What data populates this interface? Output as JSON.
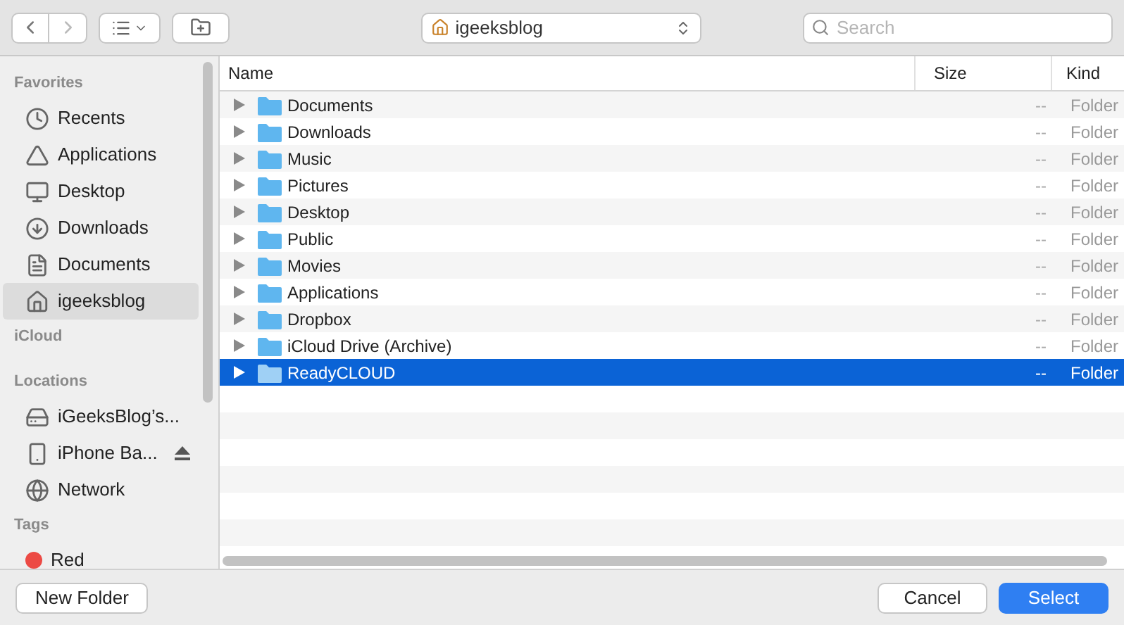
{
  "toolbar": {
    "path": "igeeksblog",
    "search": {
      "placeholder": "Search"
    }
  },
  "sidebar": {
    "sections": [
      {
        "title": "Favorites",
        "items": [
          {
            "label": "Recents",
            "kind": "recents",
            "selected": false
          },
          {
            "label": "Applications",
            "kind": "applications",
            "selected": false
          },
          {
            "label": "Desktop",
            "kind": "desktop",
            "selected": false
          },
          {
            "label": "Downloads",
            "kind": "downloads",
            "selected": false
          },
          {
            "label": "Documents",
            "kind": "documents",
            "selected": false
          },
          {
            "label": "igeeksblog",
            "kind": "home",
            "selected": true
          }
        ]
      },
      {
        "title": "iCloud"
      },
      {
        "title": "Locations",
        "items": [
          {
            "label": "iGeeksBlog’s...",
            "kind": "drive",
            "selected": false,
            "eject": false
          },
          {
            "label": "iPhone Ba...",
            "kind": "disk",
            "selected": false,
            "eject": true
          },
          {
            "label": "Network",
            "kind": "network",
            "selected": false,
            "eject": false
          }
        ]
      },
      {
        "title": "Tags",
        "items": [
          {
            "label": "Red",
            "kind": "tag",
            "color": "#ec4a44",
            "selected": false
          }
        ]
      }
    ]
  },
  "table": {
    "columns": [
      "Name",
      "Size",
      "Kind"
    ],
    "rows": [
      {
        "name": "Documents",
        "size": "--",
        "kind": "Folder",
        "selected": false
      },
      {
        "name": "Downloads",
        "size": "--",
        "kind": "Folder",
        "selected": false
      },
      {
        "name": "Music",
        "size": "--",
        "kind": "Folder",
        "selected": false
      },
      {
        "name": "Pictures",
        "size": "--",
        "kind": "Folder",
        "selected": false
      },
      {
        "name": "Desktop",
        "size": "--",
        "kind": "Folder",
        "selected": false
      },
      {
        "name": "Public",
        "size": "--",
        "kind": "Folder",
        "selected": false
      },
      {
        "name": "Movies",
        "size": "--",
        "kind": "Folder",
        "selected": false
      },
      {
        "name": "Applications",
        "size": "--",
        "kind": "Folder",
        "selected": false
      },
      {
        "name": "Dropbox",
        "size": "--",
        "kind": "Folder",
        "selected": false
      },
      {
        "name": "iCloud Drive (Archive)",
        "size": "--",
        "kind": "Folder",
        "selected": false
      },
      {
        "name": "ReadyCLOUD",
        "size": "--",
        "kind": "Folder",
        "selected": true
      }
    ]
  },
  "buttons": {
    "new_folder": "New Folder",
    "cancel": "Cancel",
    "select": "Select"
  }
}
